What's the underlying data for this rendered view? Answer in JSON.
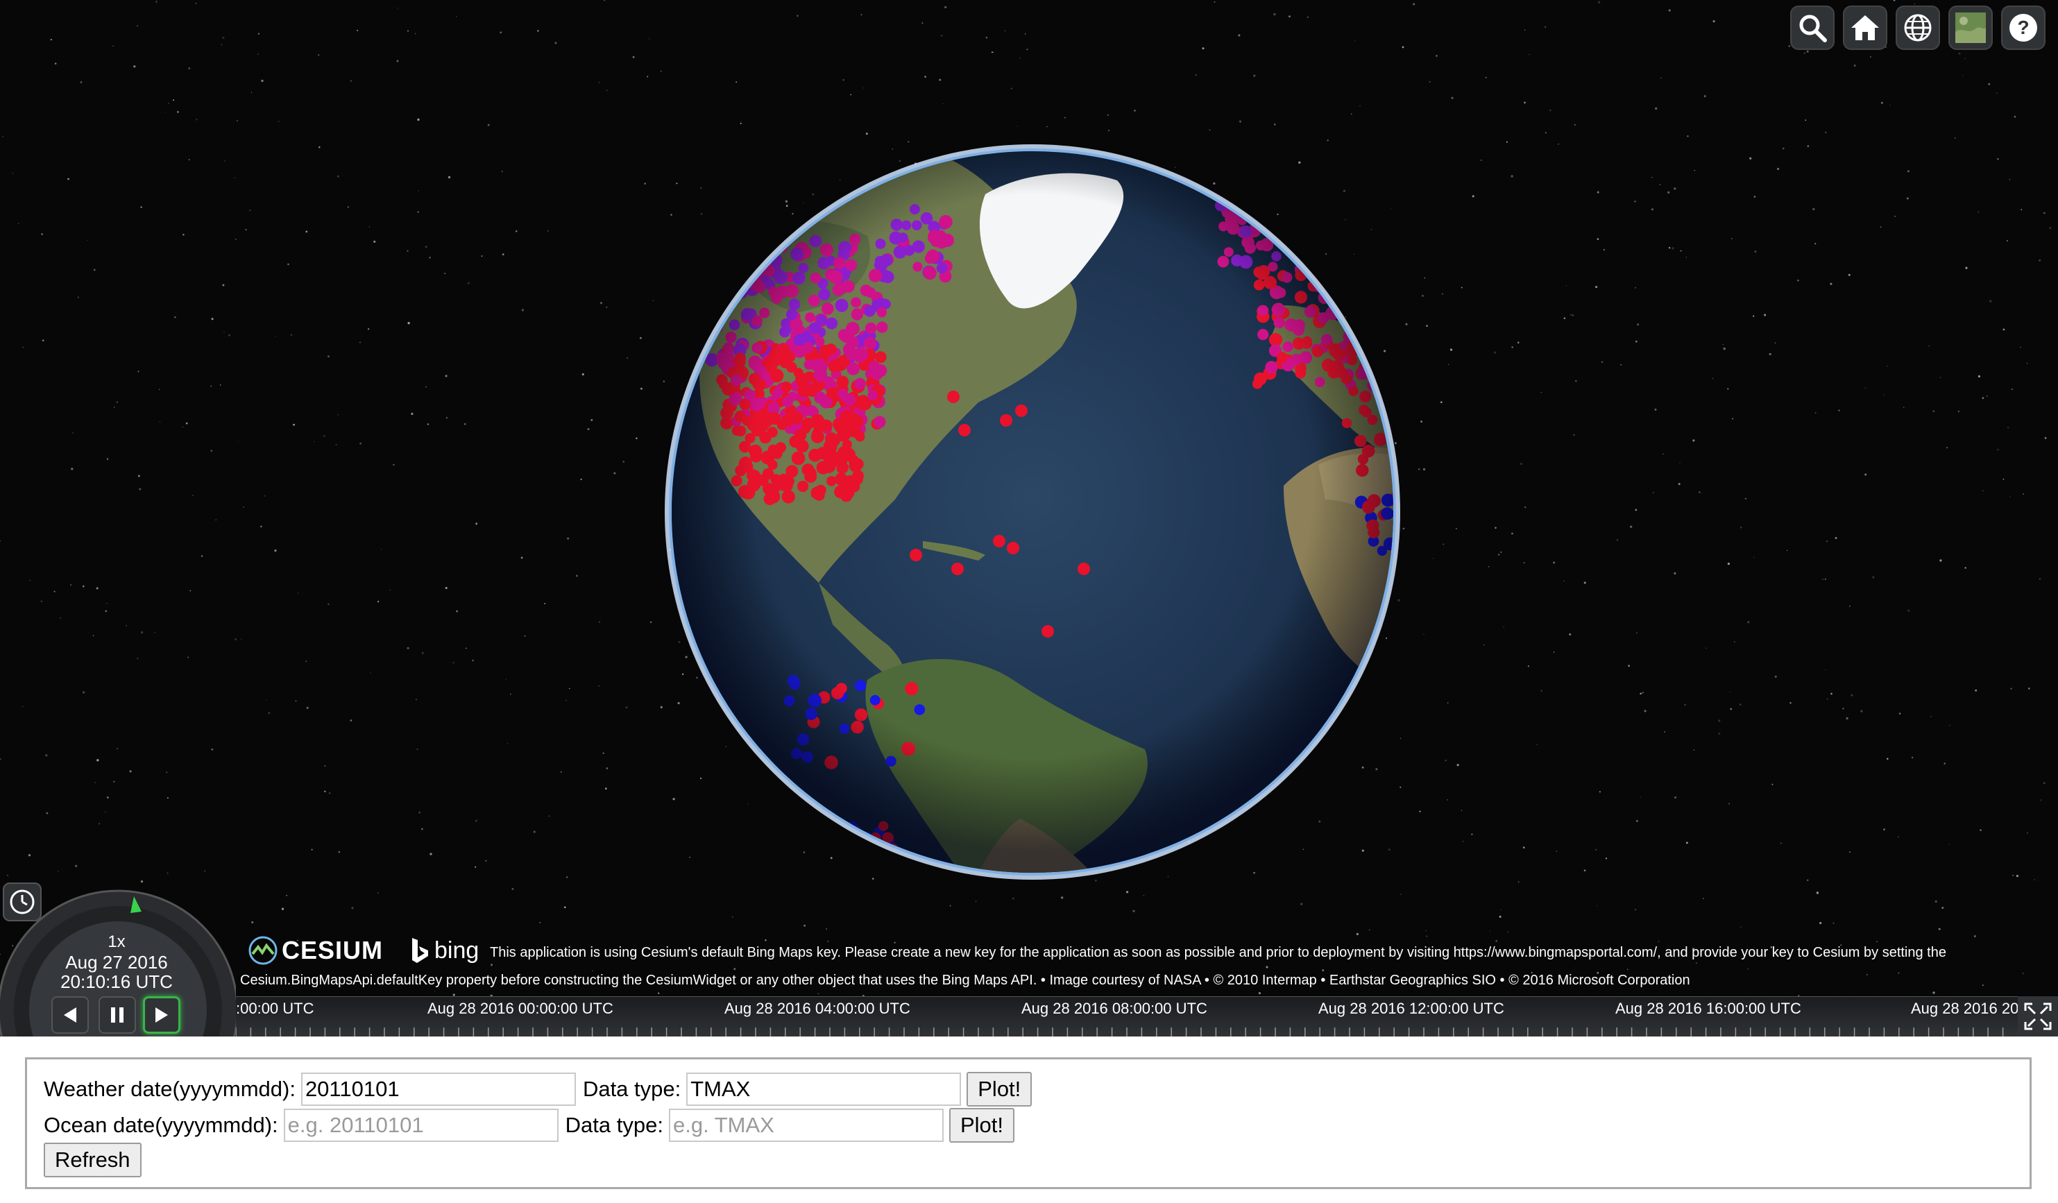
{
  "toolbar": {
    "buttons": [
      "search-icon",
      "home-icon",
      "globe-icon",
      "imagery-icon",
      "help-icon"
    ]
  },
  "credits": {
    "cesium_logo": "CESIUM",
    "bing_logo": "bing",
    "line1": "This application is using Cesium's default Bing Maps key. Please create a new key for the application as soon as possible and prior to deployment by visiting https://www.bingmapsportal.com/, and provide your key to Cesium by setting the",
    "line2": "Cesium.BingMapsApi.defaultKey property before constructing the CesiumWidget or any other object that uses the Bing Maps API. • Image courtesy of NASA • © 2010 Intermap • Earthstar Geographics SIO • © 2016 Microsoft Corporation"
  },
  "animation": {
    "speed": "1x",
    "date": "Aug 27 2016",
    "time": "20:10:16 UTC"
  },
  "timeline": {
    "labels": [
      ":00:00 UTC",
      "Aug 28 2016 00:00:00 UTC",
      "Aug 28 2016 04:00:00 UTC",
      "Aug 28 2016 08:00:00 UTC",
      "Aug 28 2016 12:00:00 UTC",
      "Aug 28 2016 16:00:00 UTC",
      "Aug 28 2016 20"
    ]
  },
  "form": {
    "weather_label": "Weather date(yyyymmdd):",
    "weather_date_value": "20110101",
    "weather_type_label": "Data type:",
    "weather_type_value": "TMAX",
    "plot_label": "Plot!",
    "ocean_label": "Ocean date(yyyymmdd):",
    "ocean_date_placeholder": "e.g. 20110101",
    "ocean_type_label": "Data type:",
    "ocean_type_placeholder": "e.g. TMAX",
    "refresh_label": "Refresh"
  },
  "colors": {
    "hot": "#e8122c",
    "warm": "#d0128a",
    "cold_violet": "#8a1fd0",
    "cool": "#1818e8"
  }
}
